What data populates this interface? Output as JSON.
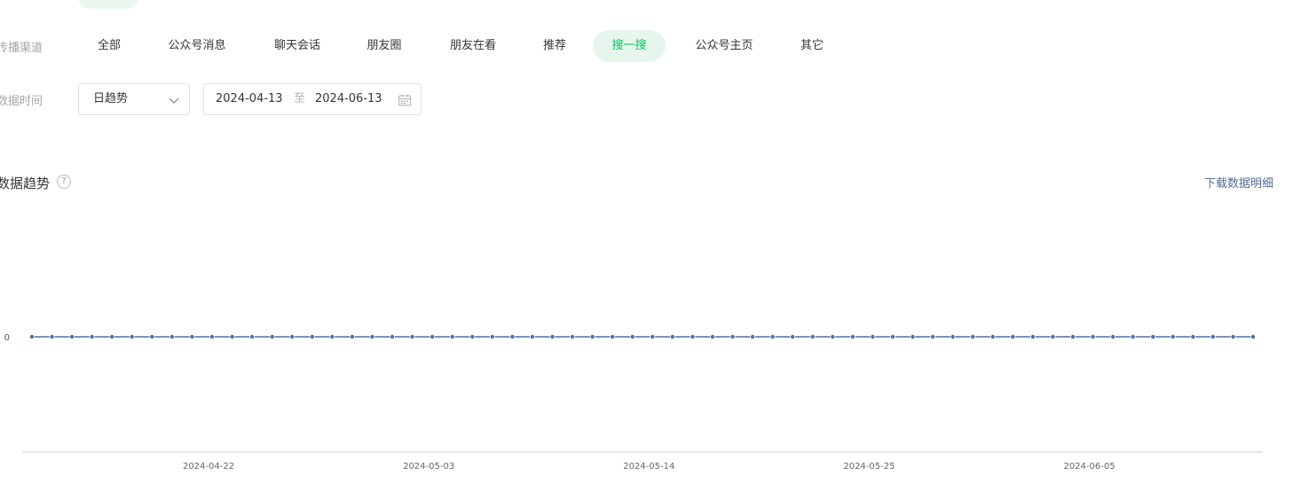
{
  "filters": {
    "channel_label": "传播渠道",
    "channels": [
      {
        "label": "全部"
      },
      {
        "label": "公众号消息"
      },
      {
        "label": "聊天会话"
      },
      {
        "label": "朋友圈"
      },
      {
        "label": "朋友在看"
      },
      {
        "label": "推荐"
      },
      {
        "label": "搜一搜",
        "active": true
      },
      {
        "label": "公众号主页"
      },
      {
        "label": "其它"
      }
    ],
    "time_label": "数据时间",
    "granularity": "日趋势",
    "date_start": "2024-04-13",
    "date_separator": "至",
    "date_end": "2024-06-13"
  },
  "trend": {
    "title": "数据趋势",
    "help_glyph": "?",
    "download_label": "下载数据明细"
  },
  "colors": {
    "accent": "#07c160",
    "accent_bg": "#e6f6ec",
    "link": "#576b95",
    "series": "#4e6fa3"
  },
  "chart_data": {
    "type": "line",
    "x_start": "2024-04-13",
    "x_end": "2024-06-13",
    "x_tick_labels": [
      "2024-04-22",
      "2024-05-03",
      "2024-05-14",
      "2024-05-25",
      "2024-06-05"
    ],
    "y_tick_labels": [
      "0"
    ],
    "series": [
      {
        "values": [
          0,
          0,
          0,
          0,
          0,
          0,
          0,
          0,
          0,
          0,
          0,
          0,
          0,
          0,
          0,
          0,
          0,
          0,
          0,
          0,
          0,
          0,
          0,
          0,
          0,
          0,
          0,
          0,
          0,
          0,
          0,
          0,
          0,
          0,
          0,
          0,
          0,
          0,
          0,
          0,
          0,
          0,
          0,
          0,
          0,
          0,
          0,
          0,
          0,
          0,
          0,
          0,
          0,
          0,
          0,
          0,
          0,
          0,
          0,
          0,
          0,
          0
        ]
      }
    ]
  }
}
